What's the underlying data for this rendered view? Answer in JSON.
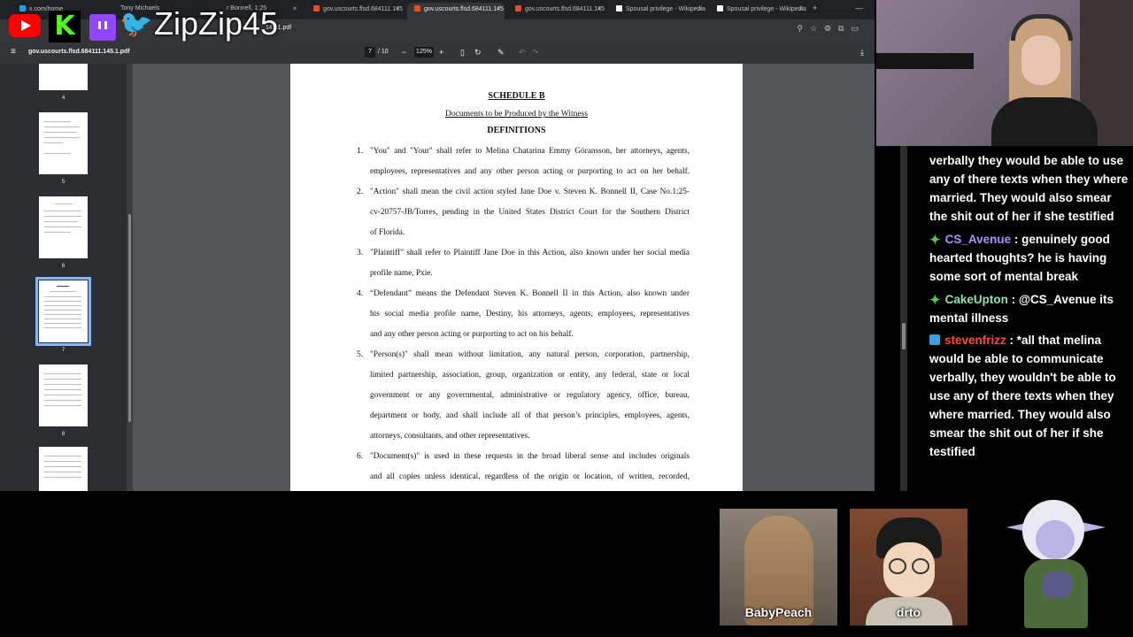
{
  "browser": {
    "tabs": [
      {
        "label": "x.com/home",
        "color": "#1da1f2"
      },
      {
        "label": "Tony Michaels",
        "color": "#888888"
      },
      {
        "label": "r Bonnell, 1:25",
        "color": "#e34c26"
      },
      {
        "label": "gov.uscourts.flsd.684111.145",
        "color": "#e34c26"
      },
      {
        "label": "gov.uscourts.flsd.684111.145",
        "color": "#e34c26"
      },
      {
        "label": "gov.uscourts.flsd.684111.145",
        "color": "#e34c26"
      },
      {
        "label": "Spousal privilege - Wikipedia",
        "color": "#ffffff"
      },
      {
        "label": "Spousal privilege - Wikipedia",
        "color": "#ffffff"
      }
    ],
    "url": "145.1.pdf",
    "new_tab": "+",
    "minimize": "—"
  },
  "pdf": {
    "title": "gov.uscourts.flsd.684111.145.1.pdf",
    "current_page": "7",
    "total_pages": "/ 10",
    "zoom": "125%",
    "thumbnail_labels": [
      "4",
      "5",
      "6",
      "7",
      "8"
    ]
  },
  "document": {
    "schedule": "SCHEDULE B",
    "subtitle": "Documents to be Produced by the Witness",
    "heading": "DEFINITIONS",
    "items": [
      {
        "num": "1.",
        "lines": [
          "\"You\" and \"Your\" shall refer to Melina Chatarina Emmy Göransson, her attorneys, agents,",
          "employees, representatives and any other person acting or purporting to act on her behalf."
        ]
      },
      {
        "num": "2.",
        "lines": [
          "\"Action\" shall mean the civil action styled Jane Doe v. Steven K. Bonnell II, Case No.1:25-",
          "cv-20757-JB/Torres, pending in the United States District Court for the Southern District",
          "of Florida."
        ]
      },
      {
        "num": "3.",
        "lines": [
          "\"Plaintiff\" shall refer to Plaintiff Jane Doe in this Action, also known under her social media",
          "profile name, Pxie."
        ]
      },
      {
        "num": "4.",
        "lines": [
          "“Defendant” means the Defendant Steven K. Bonnell II in this Action, also known under",
          "his social media profile name, Destiny, his attorneys, agents, employees, representatives",
          "and any other person acting or purporting to act on his behalf."
        ]
      },
      {
        "num": "5.",
        "lines": [
          "\"Person(s)\" shall mean without limitation, any natural person, corporation, partnership,",
          "limited partnership, association, group, organization or entity, any federal, state or local",
          "government or any governmental, administrative or regulatory agency, office, bureau,",
          "department or body, and shall include all of that person’s principles, employees, agents,",
          "attorneys, consultants, and other representatives."
        ]
      },
      {
        "num": "6.",
        "lines": [
          "\"Document(s)\" is used in these requests in the broad liberal sense and includes originals",
          "and all copies unless identical, regardless of the origin or location, of written, recorded,"
        ]
      }
    ]
  },
  "overlay": {
    "kick_glyph": "K",
    "handle": "ZipZip45"
  },
  "chat": {
    "continuation": "verbally they would be able to use any of there texts when they where married. They would also smear the shit out of her if she testified",
    "messages": [
      {
        "user": "CS_Avenue",
        "user_color": "#b18cff",
        "badge": "plus",
        "text": "genuinely good hearted thoughts? he is having some sort of mental break"
      },
      {
        "user": "CakeUpton",
        "user_color": "#8fe0a8",
        "badge": "plus",
        "text": "@CS_Avenue its mental illness"
      },
      {
        "user": "stevenfrizz",
        "user_color": "#ff4a3d",
        "badge": "cloud",
        "text": "*all that melina would be able to communicate verbally, they wouldn't be able to use any of there texts when they where married. They would also smear the shit out of her if she testified"
      }
    ],
    "separator": " : "
  },
  "cams": {
    "left": "BabyPeach",
    "right": "drto"
  }
}
